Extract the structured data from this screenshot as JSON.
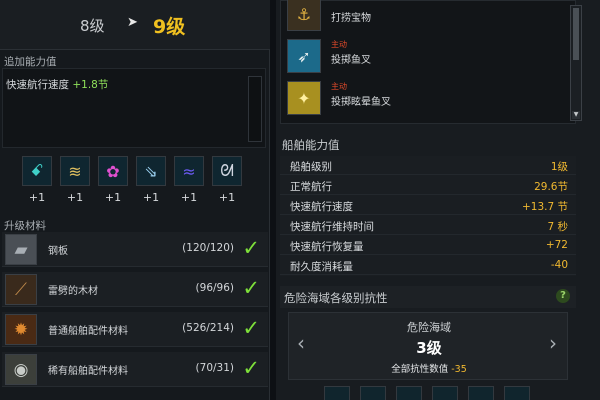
{
  "level": {
    "from": "8级",
    "arrow": "➤",
    "to": "9级"
  },
  "bonus": {
    "title": "追加能力值",
    "line_label": "快速航行速度",
    "line_value": "+1.8节"
  },
  "abilities": [
    {
      "icon": "water-swirl-icon",
      "glyph": "ꗃ",
      "color": "#3fd0c8",
      "bonus": "+1"
    },
    {
      "icon": "tornado-icon",
      "glyph": "≋",
      "color": "#e0c060",
      "bonus": "+1"
    },
    {
      "icon": "fish-icon",
      "glyph": "✿",
      "color": "#e050d0",
      "bonus": "+1"
    },
    {
      "icon": "rain-icon",
      "glyph": "⇘",
      "color": "#9ad0f0",
      "bonus": "+1"
    },
    {
      "icon": "wave-icon",
      "glyph": "≈",
      "color": "#6a5af0",
      "bonus": "+1"
    },
    {
      "icon": "wind-icon",
      "glyph": "ᘛ",
      "color": "#d0d6e0",
      "bonus": "+1"
    }
  ],
  "materials": {
    "title": "升级材料",
    "items": [
      {
        "icon": "steel-plate-icon",
        "glyph": "▰",
        "color": "#a8aeb4",
        "bg": "#4a4f55",
        "name": "钢板",
        "count": "(120/120)"
      },
      {
        "icon": "lightning-wood-icon",
        "glyph": "⟋",
        "color": "#c08a4a",
        "bg": "#3a2a1c",
        "name": "雷劈的木材",
        "count": "(96/96)"
      },
      {
        "icon": "gear-part-icon",
        "glyph": "✹",
        "color": "#e08a30",
        "bg": "#4a2a14",
        "name": "普通船舶配件材料",
        "count": "(526/214)"
      },
      {
        "icon": "rare-part-icon",
        "glyph": "◉",
        "color": "#c8ccc8",
        "bg": "#3c3f3a",
        "name": "稀有船舶配件材料",
        "count": "(70/31)"
      }
    ]
  },
  "skills": [
    {
      "icon": "treasure-chest-icon",
      "glyph": "⚓",
      "color": "#e0b040",
      "bg": "#3a3020",
      "tag": "",
      "name": "打捞宝物"
    },
    {
      "icon": "harpoon-icon",
      "glyph": "➶",
      "color": "#e8f0f0",
      "bg": "#1c6a8a",
      "tag": "主动",
      "name": "投掷鱼叉"
    },
    {
      "icon": "stun-harpoon-icon",
      "glyph": "✦",
      "color": "#fff0a0",
      "bg": "#a89020",
      "tag": "主动",
      "name": "投掷眩晕鱼叉"
    }
  ],
  "stats": {
    "title": "船舶能力值",
    "rows": [
      {
        "label": "船舶级别",
        "value": "1级"
      },
      {
        "label": "正常航行",
        "value": "29.6节"
      },
      {
        "label": "快速航行速度",
        "value": "+13.7 节"
      },
      {
        "label": "快速航行维持时间",
        "value": "7 秒"
      },
      {
        "label": "快速航行恢复量",
        "value": "+72"
      },
      {
        "label": "耐久度消耗量",
        "value": "-40"
      }
    ]
  },
  "danger": {
    "title": "危险海域各级别抗性",
    "help": "?",
    "name": "危险海域",
    "level": "3级",
    "resist_label": "全部抗性数值",
    "resist_value": "-35",
    "prev": "‹",
    "next": "›"
  }
}
